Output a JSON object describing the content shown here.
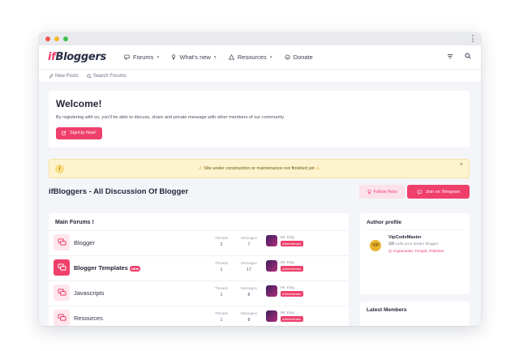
{
  "nav": {
    "logo_prefix": "if",
    "logo_main": "Bloggers",
    "items": [
      {
        "label": "Forums",
        "icon": "chat-icon"
      },
      {
        "label": "What's new",
        "icon": "bulb-icon"
      },
      {
        "label": "Resources",
        "icon": "warning-icon"
      },
      {
        "label": "Donate",
        "icon": "donate-icon"
      }
    ]
  },
  "subnav": {
    "new_posts": "New Posts",
    "search_forums": "Search Forums"
  },
  "welcome": {
    "title": "Welcome!",
    "text": "By registering with us, you'll be able to discuss, share and private message with other members of our community.",
    "button": "SignUp Now!"
  },
  "notice": {
    "warn_left": "⚠",
    "text": "Site under construction or maintenance not finished yet",
    "warn_right": "⚠",
    "info": "i",
    "close": "×"
  },
  "page": {
    "title": "ifBloggers - All Discussion Of Blogger",
    "follow_button": "Follow Now",
    "telegram_button": "Join on Telegram"
  },
  "forums": {
    "heading": "Main Forums !",
    "threads_label": "Threads",
    "messages_label": "Messages",
    "rows": [
      {
        "name": "Blogger",
        "threads": "2",
        "messages": "7",
        "user": "Mr. King",
        "role": "Administrator",
        "new": ""
      },
      {
        "name": "Blogger Templates",
        "threads": "1",
        "messages": "17",
        "user": "Mr. King",
        "role": "Administrator",
        "new": "NEW"
      },
      {
        "name": "Javascripts",
        "threads": "1",
        "messages": "8",
        "user": "Mr. King",
        "role": "Administrator",
        "new": ""
      },
      {
        "name": "Resources",
        "threads": "1",
        "messages": "8",
        "user": "Mr. King",
        "role": "Administrator",
        "new": ""
      }
    ]
  },
  "author": {
    "heading": "Author profile",
    "name": "VipCodeMaster",
    "tagline": "code your dream blogger",
    "location": "Gujranwala, Punjab, Pakistan",
    "badge": "VIP"
  },
  "members": {
    "heading": "Latest Members"
  },
  "colors": {
    "accent": "#ef3f6b",
    "notice_bg": "#fdf3cf"
  }
}
